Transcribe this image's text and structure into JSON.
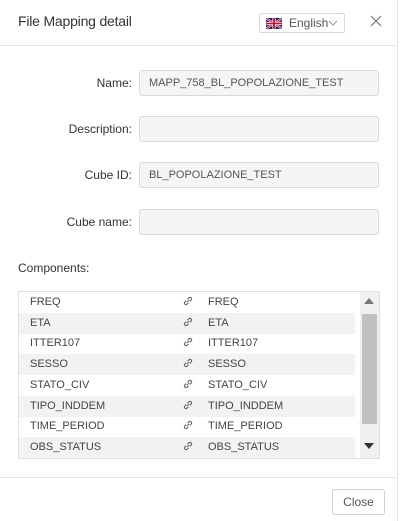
{
  "dialog": {
    "title": "File Mapping detail",
    "language": {
      "selected": "English",
      "flag_icon": "uk-flag-icon"
    },
    "close_icon": "close-icon"
  },
  "form": {
    "name": {
      "label": "Name",
      "value": "MAPP_758_BL_POPOLAZIONE_TEST"
    },
    "description": {
      "label": "Description",
      "value": ""
    },
    "cube_id": {
      "label": "Cube ID",
      "value": "BL_POPOLAZIONE_TEST"
    },
    "cube_name": {
      "label": "Cube name",
      "value": ""
    }
  },
  "components": {
    "label": "Components",
    "link_icon": "link-icon",
    "rows": [
      {
        "source": "FREQ",
        "target": "FREQ"
      },
      {
        "source": "ETA",
        "target": "ETA"
      },
      {
        "source": "ITTER107",
        "target": "ITTER107"
      },
      {
        "source": "SESSO",
        "target": "SESSO"
      },
      {
        "source": "STATO_CIV",
        "target": "STATO_CIV"
      },
      {
        "source": "TIPO_INDDEM",
        "target": "TIPO_INDDEM"
      },
      {
        "source": "TIME_PERIOD",
        "target": "TIME_PERIOD"
      },
      {
        "source": "OBS_STATUS",
        "target": "OBS_STATUS"
      }
    ]
  },
  "footer": {
    "close_label": "Close"
  },
  "colors": {
    "border": "#d9d9d9",
    "input_bg": "#f5f5f5",
    "alt_row": "#f2f2f2",
    "scroll_thumb": "#c1c1c1"
  }
}
